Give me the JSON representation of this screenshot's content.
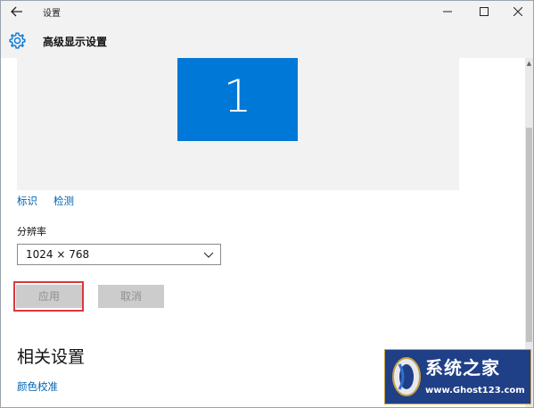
{
  "window": {
    "title": "设置",
    "back_icon": "back-arrow-icon",
    "controls": [
      "minimize-icon",
      "maximize-icon",
      "close-icon"
    ]
  },
  "header": {
    "icon": "gear-icon",
    "title": "高级显示设置"
  },
  "display": {
    "monitor_number": "1",
    "monitor_color": "#0078d7",
    "identify_link": "标识",
    "detect_link": "检测"
  },
  "resolution": {
    "label": "分辨率",
    "selected": "1024 × 768"
  },
  "actions": {
    "apply_label": "应用",
    "cancel_label": "取消",
    "highlight_color": "#d9393e"
  },
  "related": {
    "title": "相关设置",
    "color_calibration_link": "颜色校准"
  },
  "watermark": {
    "brand": "系统之家",
    "url": "www.Ghost123.com"
  },
  "colors": {
    "accent": "#0078d7",
    "link": "#0063b1",
    "chrome": "#f2f2f2"
  }
}
